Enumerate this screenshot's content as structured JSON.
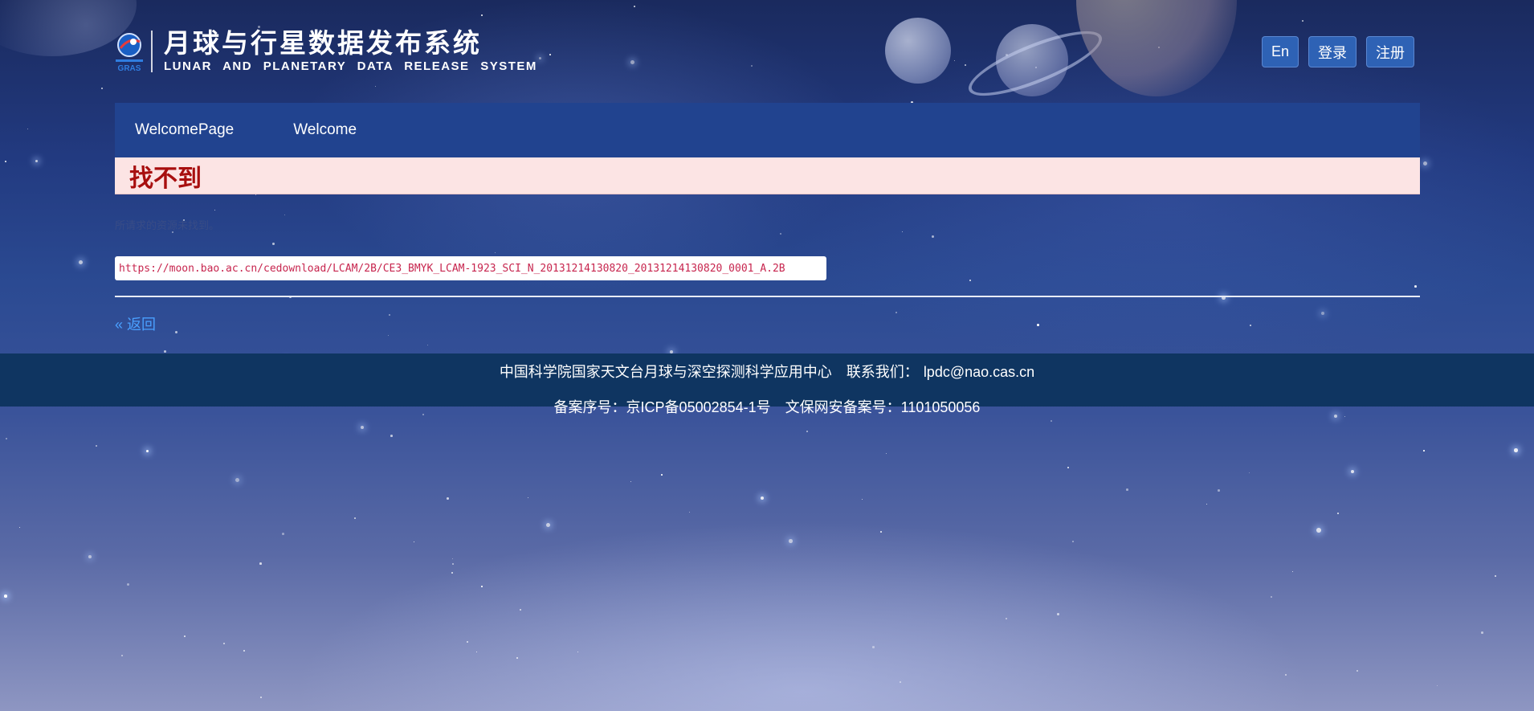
{
  "header": {
    "logo_cn": "月球与行星数据发布系统",
    "logo_en": "LUNAR AND PLANETARY DATA RELEASE SYSTEM",
    "logo_mark_text": "GRAS",
    "buttons": {
      "lang": "En",
      "login": "登录",
      "register": "注册"
    }
  },
  "nav": {
    "items": [
      {
        "label": "WelcomePage"
      },
      {
        "label": "Welcome"
      }
    ]
  },
  "error": {
    "title": "找不到",
    "description": "所请求的资源未找到。",
    "url": "https://moon.bao.ac.cn/cedownload/LCAM/2B/CE3_BMYK_LCAM-1923_SCI_N_20131214130820_20131214130820_0001_A.2B"
  },
  "back_link": "« 返回",
  "footer": {
    "org": "中国科学院国家天文台月球与深空探测科学应用中心",
    "contact_label": "联系我们：",
    "contact_email": "lpdc@nao.cas.cn",
    "icp": "备案序号：京ICP备05002854-1号",
    "security": "文保网安备案号：1101050056"
  },
  "colors": {
    "nav_bg": "#21438f",
    "button_bg": "#2e62b5",
    "error_bg": "#fce4e4",
    "error_text": "#a80f0f",
    "footer_bg": "#0f3561",
    "link": "#4aa0ff"
  }
}
